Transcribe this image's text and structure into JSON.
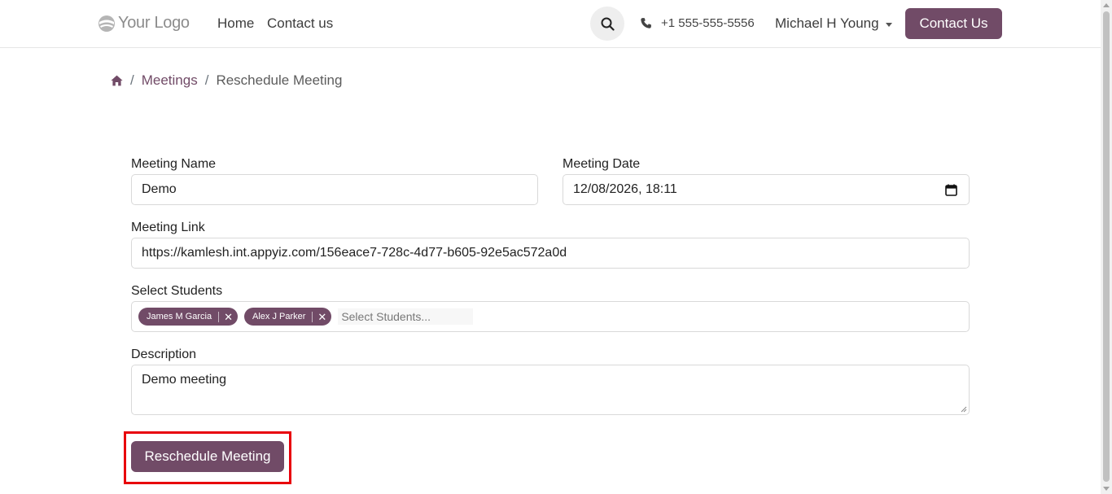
{
  "header": {
    "logo_text": "Your Logo",
    "nav": [
      "Home",
      "Contact us"
    ],
    "phone": "+1 555-555-5556",
    "user_name": "Michael H Young",
    "contact_button": "Contact Us"
  },
  "breadcrumb": {
    "items": [
      "Meetings",
      "Reschedule Meeting"
    ]
  },
  "form": {
    "meeting_name": {
      "label": "Meeting Name",
      "value": "Demo"
    },
    "meeting_date": {
      "label": "Meeting Date",
      "value": "12/08/2026, 18:11"
    },
    "meeting_link": {
      "label": "Meeting Link",
      "value": "https://kamlesh.int.appyiz.com/156eace7-728c-4d77-b605-92e5ac572a0d"
    },
    "students": {
      "label": "Select Students",
      "tags": [
        "James M Garcia",
        "Alex J Parker"
      ],
      "placeholder": "Select Students..."
    },
    "description": {
      "label": "Description",
      "value": "Demo meeting"
    },
    "submit_label": "Reschedule Meeting"
  },
  "colors": {
    "brand": "#714b67",
    "highlight": "#e8000b"
  }
}
